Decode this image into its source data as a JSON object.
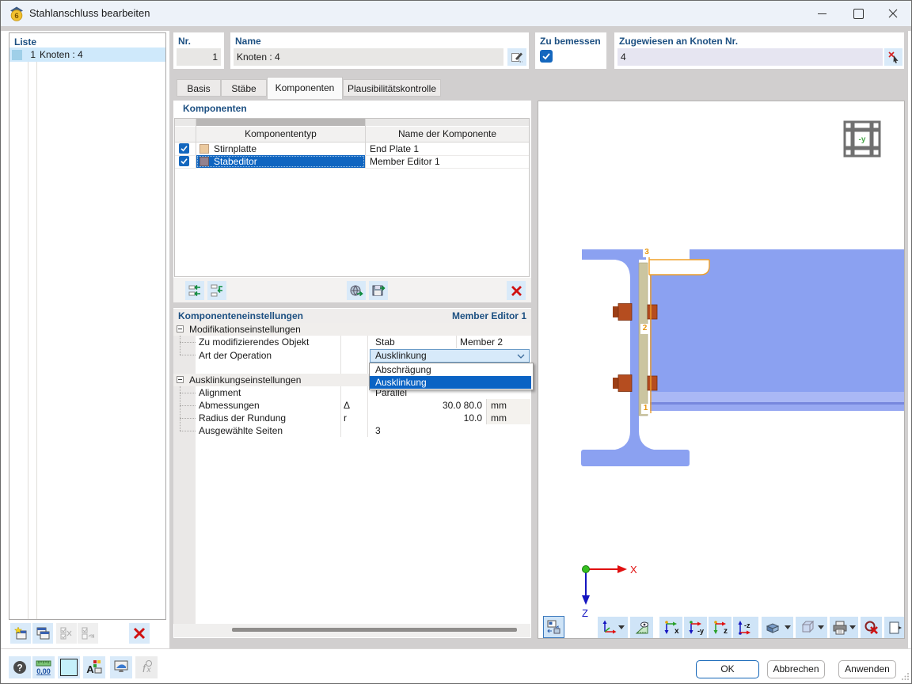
{
  "window": {
    "title": "Stahlanschluss bearbeiten"
  },
  "list_panel": {
    "label": "Liste",
    "row": {
      "nr": "1",
      "name": "Knoten : 4",
      "swatch_color": "#9fcfe8"
    }
  },
  "fields": {
    "nr": {
      "label": "Nr.",
      "value": "1"
    },
    "name": {
      "label": "Name",
      "value": "Knoten : 4"
    },
    "design": {
      "label": "Zu bemessen",
      "checked": true
    },
    "assigned": {
      "label": "Zugewiesen an Knoten Nr.",
      "value": "4"
    }
  },
  "tabs": [
    {
      "label": "Basis",
      "active": false
    },
    {
      "label": "Stäbe",
      "active": false
    },
    {
      "label": "Komponenten",
      "active": true
    },
    {
      "label": "Plausibilitätskontrolle",
      "active": false
    }
  ],
  "components": {
    "title": "Komponenten",
    "columns": {
      "type": "Komponententyp",
      "name": "Name der Komponente"
    },
    "rows": [
      {
        "checked": true,
        "swatch": "#ecca9f",
        "type": "Stirnplatte",
        "name": "End Plate 1",
        "selected": false
      },
      {
        "checked": true,
        "swatch": "#94818d",
        "type": "Stabeditor",
        "name": "Member Editor 1",
        "selected": true
      }
    ]
  },
  "settings": {
    "title": "Komponenteneinstellungen",
    "component": "Member Editor 1",
    "section1": "Modifikationseinstellungen",
    "row_object": {
      "label": "Zu modifizierendes Objekt",
      "value": "Stab",
      "value2": "Member 2"
    },
    "row_operation": {
      "label": "Art der Operation",
      "value": "Ausklinkung"
    },
    "section2": "Ausklinkungseinstellungen",
    "row_alignment": {
      "label": "Alignment",
      "value": "Parallel"
    },
    "row_dimensions": {
      "label": "Abmessungen",
      "symbol": "Δ",
      "value": "30.0 80.0",
      "unit": "mm"
    },
    "row_radius": {
      "label": "Radius der Rundung",
      "symbol": "r",
      "value": "10.0",
      "unit": "mm"
    },
    "row_sides": {
      "label": "Ausgewählte Seiten",
      "value": "3"
    }
  },
  "dropdown": {
    "items": [
      {
        "label": "Abschrägung",
        "selected": false
      },
      {
        "label": "Ausklinkung",
        "selected": true
      }
    ]
  },
  "viewer": {
    "cube_label": "-y",
    "axis_x": "X",
    "axis_z": "Z",
    "part_labels": {
      "top": "3",
      "mid": "2",
      "bottom": "1"
    },
    "colors": {
      "steel": "#8ba1f1",
      "flange_light": "#aab8f5",
      "plate": "#cbc5a0",
      "bolt": "#b54d1f",
      "highlight": "#f0a028"
    }
  },
  "footer": {
    "ok": "OK",
    "cancel": "Abbrechen",
    "apply": "Anwenden"
  },
  "icons": {
    "titlebar": [
      "app-icon",
      "minimize-icon",
      "maximize-icon",
      "close-icon"
    ],
    "fields": [
      "edit-pencil-icon",
      "pick-node-icon"
    ],
    "components_toolbar": [
      "add-component-icon",
      "insert-component-icon",
      "import-component-icon",
      "save-component-icon",
      "delete-all-components-icon"
    ],
    "list_toolbar": [
      "new-item-icon",
      "copy-item-icon",
      "check-all-icon",
      "revert-check-icon",
      "delete-item-icon"
    ],
    "bottom_toolbar": [
      "help-icon",
      "units-icon",
      "background-color-icon",
      "font-color-icon",
      "display-settings-icon",
      "formula-icon"
    ],
    "viewer_toolbar": [
      "reset-view-icon",
      "axes-view-icon",
      "measure-icon",
      "view-x-icon",
      "view-minus-y-icon",
      "view-z-icon",
      "view-minus-z-icon",
      "render-mode-icon",
      "wireframe-icon",
      "print-icon",
      "zoom-cancel-icon",
      "exit-view-icon"
    ]
  }
}
